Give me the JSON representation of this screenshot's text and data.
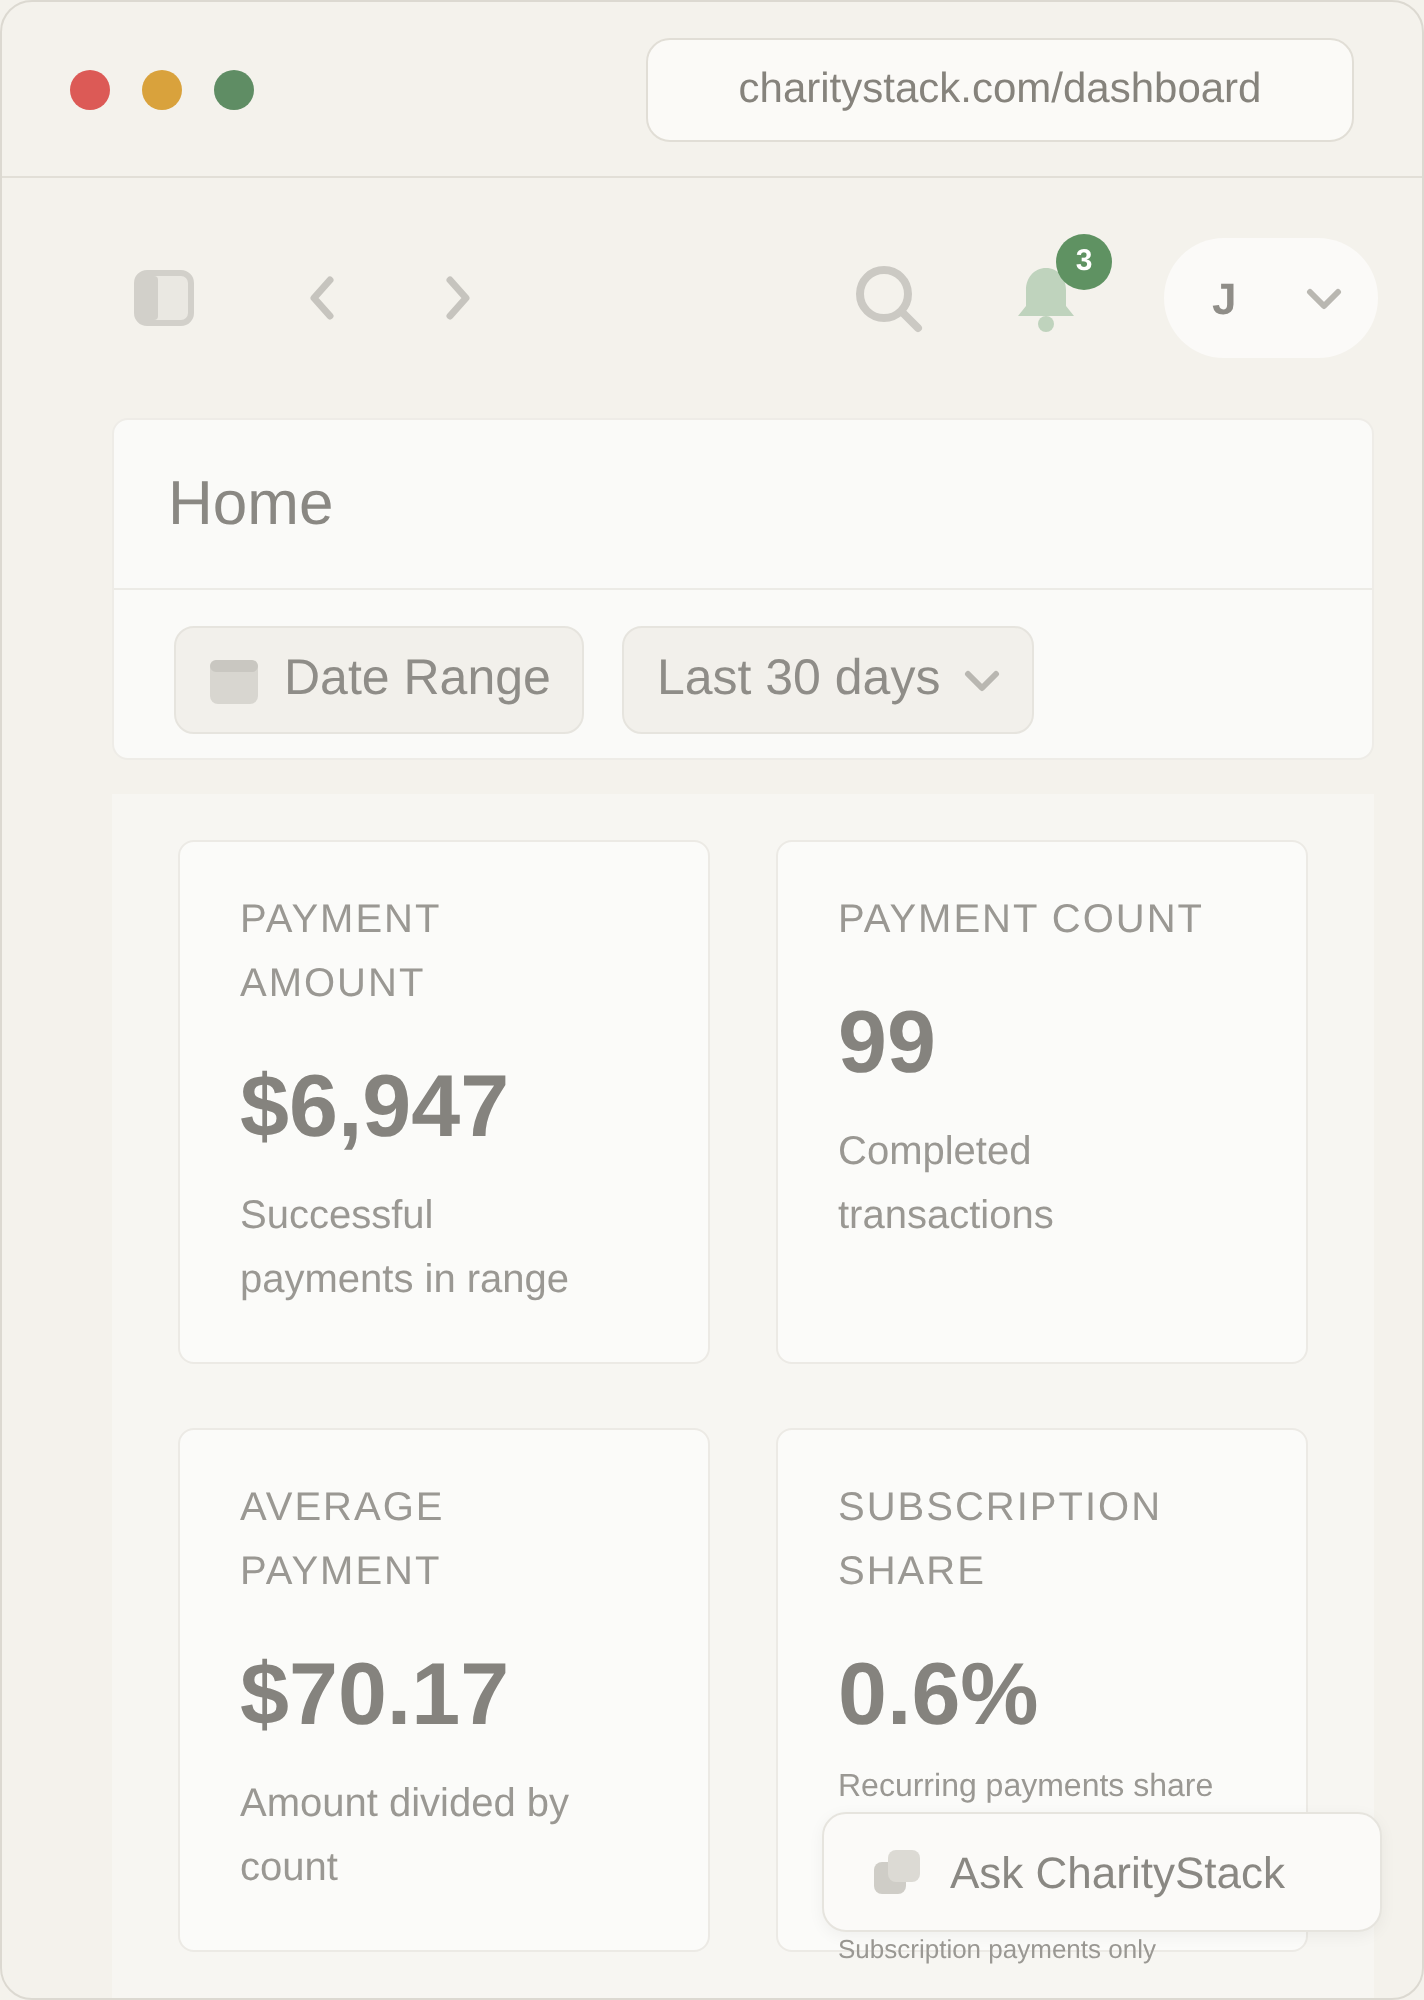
{
  "browser": {
    "url": "charitystack.com/dashboard"
  },
  "topbar": {
    "notification_count": "3",
    "avatar_initial": "J"
  },
  "header": {
    "title": "Home",
    "filters": [
      {
        "kind": "date",
        "label": "Date Range"
      },
      {
        "kind": "dropdown",
        "label": "Last 30 days"
      }
    ]
  },
  "stats": [
    {
      "label": "PAYMENT AMOUNT",
      "value": "$6,947",
      "caption": "Successful payments in range"
    },
    {
      "label": "PAYMENT COUNT",
      "value": "99",
      "caption": "Completed transactions"
    },
    {
      "label": "AVERAGE PAYMENT",
      "value": "$70.17",
      "caption": "Amount divided by count"
    },
    {
      "label": "SUBSCRIPTION SHARE",
      "value": "0.6%",
      "caption": "Recurring payments share",
      "note": "Subscription payments only"
    }
  ],
  "assistant_button": {
    "label": "Ask CharityStack"
  }
}
